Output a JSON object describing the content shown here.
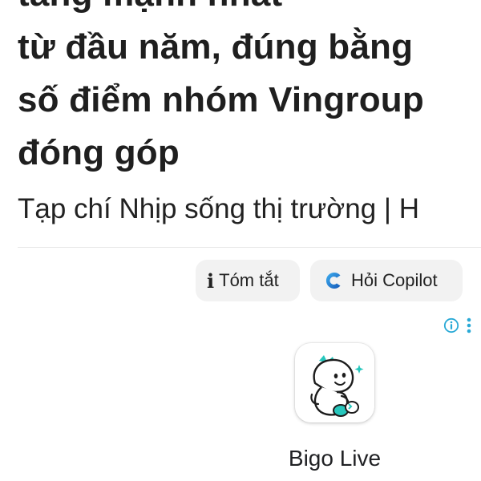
{
  "article": {
    "headline_lines": [
      "tăng mạnh nhất",
      "từ đầu năm, đúng bằng",
      "số điểm nhóm Vingroup",
      "đóng góp"
    ],
    "source": "Tạp chí Nhịp sống thị trường | H"
  },
  "actions": {
    "summary_label": "Tóm tắt",
    "copilot_label": "Hỏi Copilot"
  },
  "ad": {
    "app_name": "Bigo Live",
    "icons": {
      "info": "info-circle-icon",
      "more": "more-vertical-icon",
      "app": "bigo-live-app-icon"
    },
    "colors": {
      "info_accent": "#29a9d6",
      "mascot_accent": "#27c7bd"
    }
  },
  "colors": {
    "text": "#1f1f1f",
    "chip_bg": "#f2f2f2",
    "copilot_blue": "#1a73c9"
  }
}
